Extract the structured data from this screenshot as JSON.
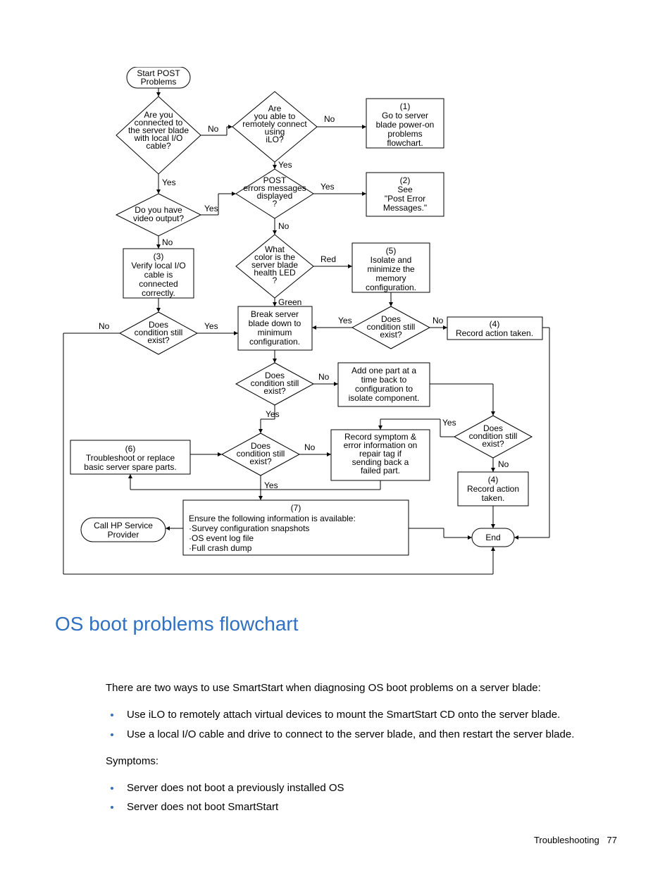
{
  "chart_data": {
    "type": "flowchart",
    "nodes": [
      {
        "id": "start",
        "shape": "terminator",
        "text": "Start POST\nProblems"
      },
      {
        "id": "d1",
        "shape": "decision",
        "text": "Are you\nconnected to\nthe server blade\nwith local I/O\ncable?"
      },
      {
        "id": "d2",
        "shape": "decision",
        "text": "Are\nyou able to\nremotely connect\nusing\niLO?"
      },
      {
        "id": "p1",
        "shape": "process",
        "text": "(1)\nGo to server\nblade power-on\nproblems\nflowchart."
      },
      {
        "id": "d3",
        "shape": "decision",
        "text": "Do you have\nvideo output?"
      },
      {
        "id": "d4",
        "shape": "decision",
        "text": "POST\nerrors messages\ndisplayed\n?"
      },
      {
        "id": "p2",
        "shape": "process",
        "text": "(2)\nSee\n\"Post Error\nMessages.\""
      },
      {
        "id": "p3",
        "shape": "process",
        "text": "(3)\nVerify local I/O\ncable is\nconnected\ncorrectly."
      },
      {
        "id": "d5",
        "shape": "decision",
        "text": "What\ncolor is the\nserver blade\nhealth LED\n?"
      },
      {
        "id": "p5",
        "shape": "process",
        "text": "(5)\nIsolate and\nminimize the\nmemory\nconfiguration."
      },
      {
        "id": "d6",
        "shape": "decision",
        "text": "Does\ncondition still\nexist?"
      },
      {
        "id": "p_break",
        "shape": "process",
        "text": "Break server\nblade down to\nminimum\nconfiguration."
      },
      {
        "id": "d7",
        "shape": "decision",
        "text": "Does\ncondition still\nexist?"
      },
      {
        "id": "p4a",
        "shape": "process",
        "text": "(4)\nRecord action taken."
      },
      {
        "id": "d8",
        "shape": "decision",
        "text": "Does\ncondition still\nexist?"
      },
      {
        "id": "p_add",
        "shape": "process",
        "text": "Add one part at a\ntime back to\nconfiguration to\nisolate component."
      },
      {
        "id": "p6",
        "shape": "process",
        "text": "(6)\nTroubleshoot or replace\nbasic server spare parts."
      },
      {
        "id": "d9",
        "shape": "decision",
        "text": "Does\ncondition still\nexist?"
      },
      {
        "id": "p_rec",
        "shape": "process",
        "text": "Record symptom &\nerror information on\nrepair tag if\nsending back a\nfailed part."
      },
      {
        "id": "d10",
        "shape": "decision",
        "text": "Does\ncondition still\nexist?"
      },
      {
        "id": "p4b",
        "shape": "process",
        "text": "(4)\nRecord action\ntaken."
      },
      {
        "id": "p_call",
        "shape": "terminator",
        "text": "Call HP Service\nProvider"
      },
      {
        "id": "p7",
        "shape": "process",
        "text": "(7)\nEnsure the following information is available:\n·Survey configuration snapshots\n·OS event log file\n·Full crash dump"
      },
      {
        "id": "end",
        "shape": "terminator",
        "text": "End"
      }
    ],
    "edges": [
      {
        "from": "start",
        "to": "d1"
      },
      {
        "from": "d1",
        "to": "d2",
        "label": "No"
      },
      {
        "from": "d1",
        "to": "d3",
        "label": "Yes"
      },
      {
        "from": "d2",
        "to": "p1",
        "label": "No"
      },
      {
        "from": "d2",
        "to": "d4",
        "label": "Yes"
      },
      {
        "from": "d3",
        "to": "d4",
        "label": "Yes"
      },
      {
        "from": "d3",
        "to": "p3",
        "label": "No"
      },
      {
        "from": "d4",
        "to": "p2",
        "label": "Yes"
      },
      {
        "from": "d4",
        "to": "d5",
        "label": "No"
      },
      {
        "from": "d5",
        "to": "p5",
        "label": "Red"
      },
      {
        "from": "d5",
        "to": "p_break",
        "label": "Green"
      },
      {
        "from": "p3",
        "to": "d6"
      },
      {
        "from": "d6",
        "to": "end_path",
        "label": "No"
      },
      {
        "from": "d6",
        "to": "p_break",
        "label": "Yes"
      },
      {
        "from": "p5",
        "to": "d7"
      },
      {
        "from": "d7",
        "to": "p_break",
        "label": "Yes"
      },
      {
        "from": "d7",
        "to": "p4a",
        "label": "No"
      },
      {
        "from": "p_break",
        "to": "d8"
      },
      {
        "from": "d8",
        "to": "p_add",
        "label": "No"
      },
      {
        "from": "d8",
        "to": "d9",
        "label": "Yes"
      },
      {
        "from": "p_add",
        "to": "d10"
      },
      {
        "from": "d9",
        "to": "p_rec",
        "label": "No"
      },
      {
        "from": "d9",
        "to": "p7",
        "label": "Yes"
      },
      {
        "from": "p6",
        "to": "d9"
      },
      {
        "from": "d10",
        "to": "p_rec",
        "label": "Yes"
      },
      {
        "from": "d10",
        "to": "p4b",
        "label": "No"
      },
      {
        "from": "p4b",
        "to": "end"
      },
      {
        "from": "p4a",
        "to": "end"
      },
      {
        "from": "p7",
        "to": "p_call"
      },
      {
        "from": "p7",
        "to": "end"
      }
    ]
  },
  "section_title": "OS boot problems flowchart",
  "intro": "There are two ways to use SmartStart when diagnosing OS boot problems on a server blade:",
  "ways": [
    "Use iLO to remotely attach virtual devices to mount the SmartStart CD onto the server blade.",
    "Use a local I/O cable and drive to connect to the server blade, and then restart the server blade."
  ],
  "symptoms_label": "Symptoms:",
  "symptoms": [
    "Server does not boot a previously installed OS",
    "Server does not boot SmartStart"
  ],
  "footer_section": "Troubleshooting",
  "footer_page": "77"
}
